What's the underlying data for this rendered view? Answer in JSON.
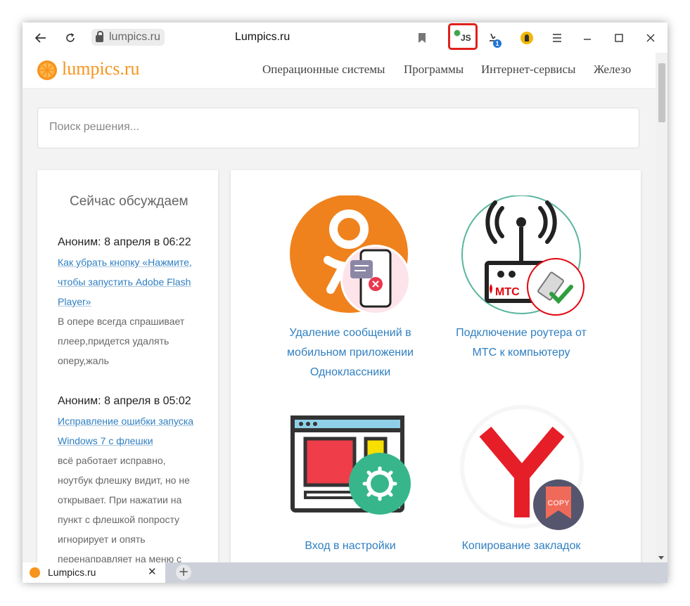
{
  "browser": {
    "url": "lumpics.ru",
    "page_title": "Lumpics.ru",
    "extension_label": "JS",
    "download_badge": "1"
  },
  "site": {
    "logo": "lumpics.ru",
    "nav": [
      "Операционные системы",
      "Программы",
      "Интернет-сервисы",
      "Железо"
    ],
    "search_placeholder": "Поиск решения..."
  },
  "sidebar": {
    "title": "Сейчас обсуждаем",
    "comments": [
      {
        "author": "Аноним: 8 апреля в 06:22",
        "link": "Как убрать кнопку «Нажмите, чтобы запустить Adobe Flash Player»",
        "text": "В опере всегда спрашивает плеер,придется удалять оперу,жаль"
      },
      {
        "author": "Аноним: 8 апреля в 05:02",
        "link": "Исправление ошибки запуска Windows 7 с флешки",
        "text": "всё работает исправно, ноутбук флешку видит, но не открывает. При нажатии на пункт с флешкой попросту игнорирует и опять перенаправляет на меню с"
      }
    ]
  },
  "articles": [
    {
      "title": "Удаление сообщений в мобильном приложении Одноклассники"
    },
    {
      "title": "Подключение роутера от МТС к компьютеру",
      "logo_text": "МТС"
    },
    {
      "title": "Вход в настройки"
    },
    {
      "title": "Копирование закладок",
      "badge_text": "COPY"
    }
  ],
  "tab": {
    "label": "Lumpics.ru",
    "close": "✕",
    "new_tab": "+"
  },
  "colors": {
    "brand_orange": "#f7941d",
    "link_blue": "#2f7fc1",
    "highlight_red": "#e0201b"
  }
}
